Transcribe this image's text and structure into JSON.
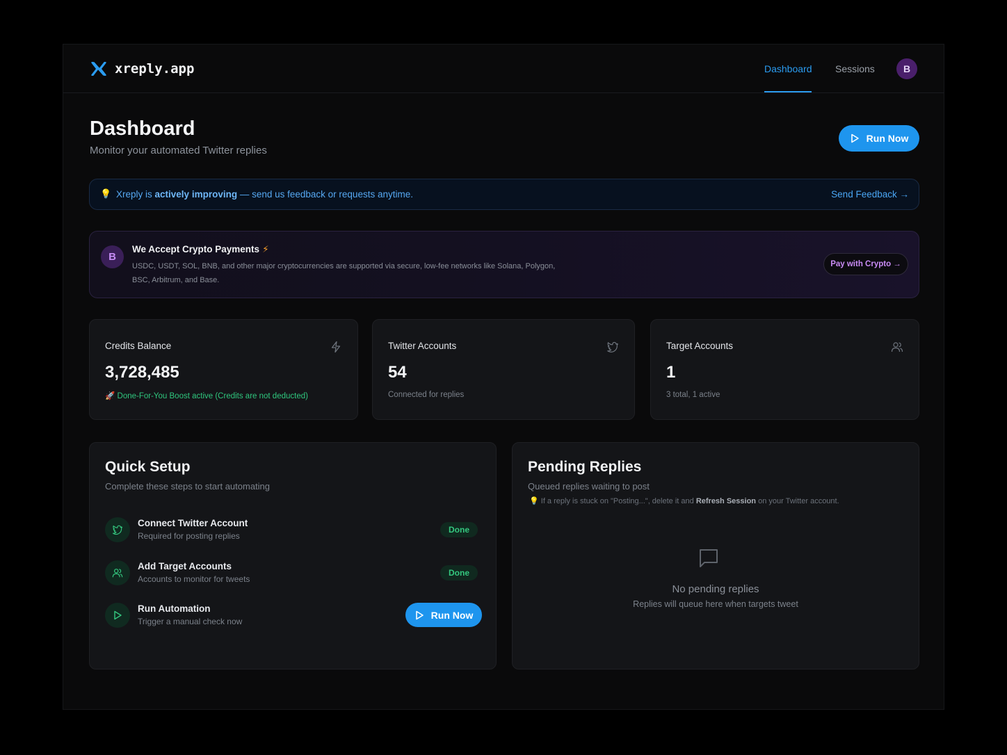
{
  "nav": {
    "brand": "xreply.app",
    "links": [
      "Dashboard",
      "Sessions"
    ],
    "active": "Dashboard",
    "avatar_initial": "B"
  },
  "header": {
    "title": "Dashboard",
    "subtitle": "Monitor your automated Twitter replies",
    "run_label": "Run Now"
  },
  "banner": {
    "lead": "Xreply is",
    "emphasis": "actively improving",
    "tail": "— send us feedback or requests anytime.",
    "link": "Send Feedback →"
  },
  "crypto": {
    "badge": "B",
    "title": "We Accept Crypto Payments",
    "description": "USDC, USDT, SOL, BNB, and other major cryptocurrencies are supported via secure, low-fee networks like Solana, Polygon, BSC, Arbitrum, and Base.",
    "button": "Pay with Crypto →"
  },
  "stats": {
    "credits": {
      "label": "Credits Balance",
      "value": "3,728,485",
      "note": "🚀 Done-For-You Boost active (Credits are not deducted)"
    },
    "twitter": {
      "label": "Twitter Accounts",
      "value": "54",
      "note": "Connected for replies"
    },
    "targets": {
      "label": "Target Accounts",
      "value": "1",
      "note": "3 total, 1 active"
    }
  },
  "setup": {
    "title": "Quick Setup",
    "subtitle": "Complete these steps to start automating",
    "steps": [
      {
        "title": "Connect Twitter Account",
        "desc": "Required for posting replies",
        "status": "Done"
      },
      {
        "title": "Add Target Accounts",
        "desc": "Accounts to monitor for tweets",
        "status": "Done"
      },
      {
        "title": "Run Automation",
        "desc": "Trigger a manual check now",
        "action": "Run Now"
      }
    ]
  },
  "pending": {
    "title": "Pending Replies",
    "subtitle": "Queued replies waiting to post",
    "tip_lead": "If a reply is stuck on \"Posting...\", delete it and",
    "tip_bold": "Refresh Session",
    "tip_tail": "on your Twitter account.",
    "empty_title": "No pending replies",
    "empty_sub": "Replies will queue here when targets tweet"
  },
  "colors": {
    "accent": "#1e95ee",
    "success": "#34c77f",
    "crypto_accent": "#c98bf5",
    "bolt": "#f59e2c"
  }
}
